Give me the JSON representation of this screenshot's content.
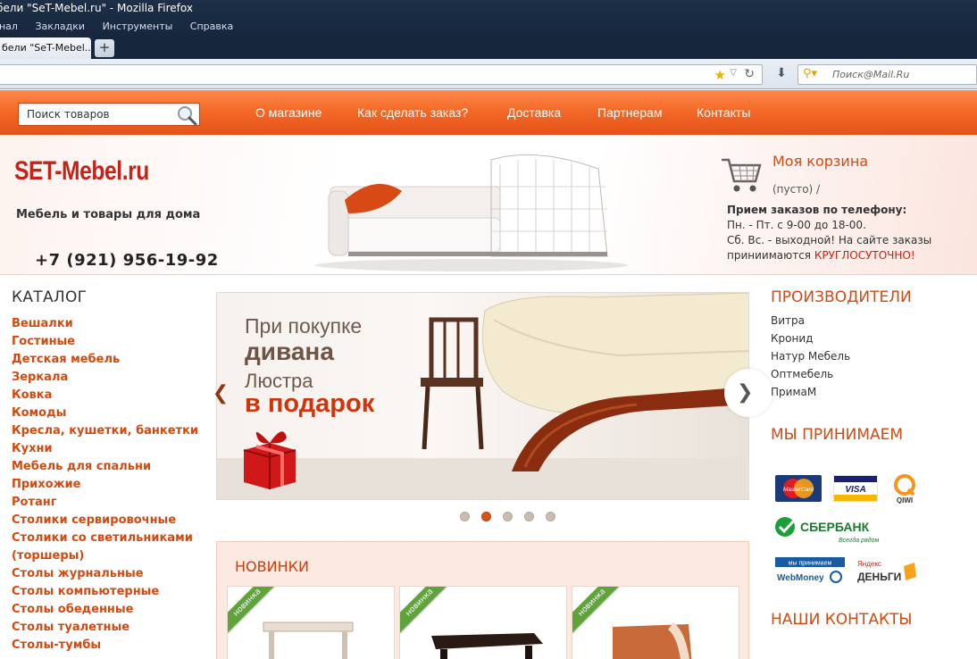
{
  "browser": {
    "window_title": "бели \"SeT-Mebel.ru\" - Mozilla Firefox",
    "menu": [
      "рнал",
      "Закладки",
      "Инструменты",
      "Справка"
    ],
    "tab_label": "бели \"SeT-Mebel...",
    "new_tab": "+",
    "search_placeholder": "Поиск@Mail.Ru"
  },
  "site": {
    "search_placeholder": "Поиск товаров",
    "nav": [
      "О магазине",
      "Как сделать заказ?",
      "Доставка",
      "Партнерам",
      "Контакты"
    ],
    "logo": "SET-Mebel.ru",
    "tagline": "Мебель и товары для дома",
    "phone": "+7 (921) 956-19-92",
    "cart": {
      "title": "Моя корзина",
      "status": "(пусто) /"
    },
    "orders": {
      "title": "Прием заказов по телефону:",
      "line1": "Пн. - Пт. с 9-00 до 18-00.",
      "line2": "Сб. Вс. - выходной! На сайте заказы",
      "line3_prefix": "приниимаются ",
      "line3_highlight": "КРУГЛОСУТОЧНО!"
    }
  },
  "catalog": {
    "title": "КАТАЛОГ",
    "items": [
      "Вешалки",
      "Гостиные",
      "Детская мебель",
      "Зеркала",
      "Ковка",
      "Комоды",
      "Кресла, кушетки, банкетки",
      "Кухни",
      "Мебель для спальни",
      "Прихожие",
      "Ротанг",
      "Столики сервировочные",
      "Столики со светильниками",
      "(торшеры)",
      "Столы журнальные",
      "Столы компьютерные",
      "Столы обеденные",
      "Столы туалетные",
      "Столы-тумбы"
    ]
  },
  "slider": {
    "line1": "При покупке",
    "line2": "дивана",
    "line3": "Люстра",
    "line4": "в подарок",
    "prev": "❮",
    "next": "❯",
    "dots_count": 5,
    "active_dot": 1
  },
  "new_products": {
    "title": "НОВИНКИ",
    "badge": "новинка"
  },
  "manufacturers": {
    "title": "ПРОИЗВОДИТЕЛИ",
    "items": [
      "Витра",
      "Кронид",
      "Натур Мебель",
      "Оптмебель",
      "ПримаМ"
    ]
  },
  "payment": {
    "title": "МЫ ПРИНИМАЕМ",
    "mastercard": "MasterCard",
    "visa": "VISA",
    "qiwi": "QIWI",
    "sberbank": "СБЕРБАНК",
    "sberbank_sub": "Всегда рядом",
    "webmoney_top": "мы принимаем",
    "webmoney": "WebMoney",
    "yandex_top": "Яндекс",
    "yandex": "ДЕНЬГИ"
  },
  "contacts": {
    "title": "НАШИ КОНТАКТЫ"
  },
  "colors": {
    "brand_orange": "#f46a28",
    "accent_red": "#d24a10",
    "logo_red": "#c4231a"
  }
}
